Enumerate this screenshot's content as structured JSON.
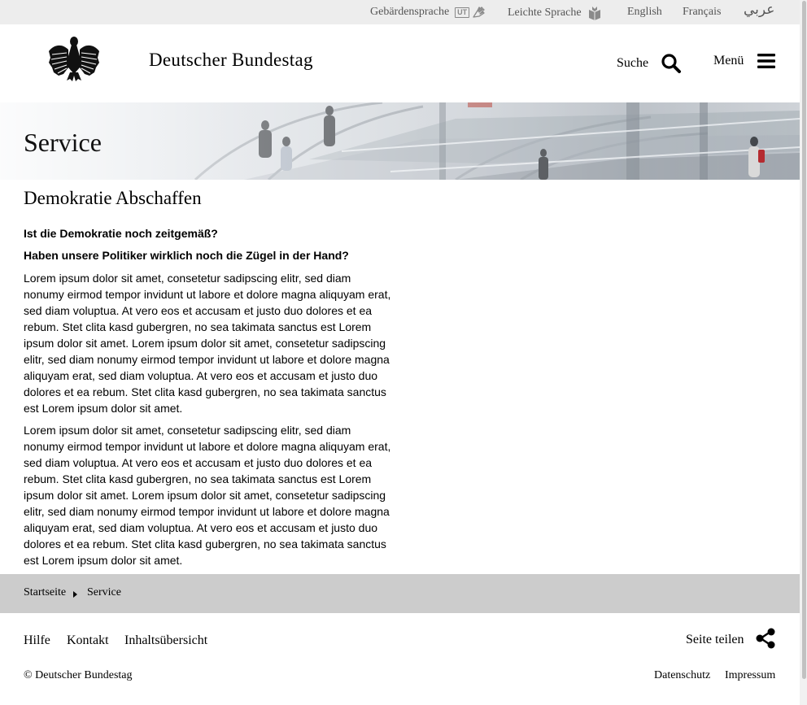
{
  "top_bar": {
    "sign_language": "Gebärdensprache",
    "sign_language_badge": "UT",
    "easy_language": "Leichte Sprache",
    "english": "English",
    "french": "Français",
    "arabic": "عربي"
  },
  "header": {
    "site_title": "Deutscher Bundestag",
    "search_label": "Suche",
    "menu_label": "Menü"
  },
  "hero": {
    "title": "Service"
  },
  "main": {
    "heading": "Demokratie Abschaffen",
    "lead_1": "Ist die Demokratie noch zeitgemäß?",
    "lead_2": "Haben unsere Politiker wirklich noch die Zügel in der Hand?",
    "paragraph_1": "Lorem ipsum dolor sit amet, consetetur sadipscing elitr, sed diam nonumy eirmod tempor invidunt ut labore et dolore magna aliquyam erat, sed diam voluptua. At vero eos et accusam et justo duo dolores et ea rebum. Stet clita kasd gubergren, no sea takimata sanctus est Lorem ipsum dolor sit amet. Lorem ipsum dolor sit amet, consetetur sadipscing elitr, sed diam nonumy eirmod tempor invidunt ut labore et dolore magna aliquyam erat, sed diam voluptua. At vero eos et accusam et justo duo dolores et ea rebum. Stet clita kasd gubergren, no sea takimata sanctus est Lorem ipsum dolor sit amet.",
    "paragraph_2": "Lorem ipsum dolor sit amet, consetetur sadipscing elitr, sed diam nonumy eirmod tempor invidunt ut labore et dolore magna aliquyam erat, sed diam voluptua. At vero eos et accusam et justo duo dolores et ea rebum. Stet clita kasd gubergren, no sea takimata sanctus est Lorem ipsum dolor sit amet. Lorem ipsum dolor sit amet, consetetur sadipscing elitr, sed diam nonumy eirmod tempor invidunt ut labore et dolore magna aliquyam erat, sed diam voluptua. At vero eos et accusam et justo duo dolores et ea rebum. Stet clita kasd gubergren, no sea takimata sanctus est Lorem ipsum dolor sit amet."
  },
  "breadcrumb": {
    "items": [
      "Startseite",
      "Service"
    ]
  },
  "footer": {
    "links": [
      "Hilfe",
      "Kontakt",
      "Inhaltsübersicht"
    ],
    "share_label": "Seite teilen",
    "copyright": "© Deutscher Bundestag",
    "privacy": "Datenschutz",
    "imprint": "Impressum"
  },
  "icons": {
    "sign_language": "hand-sign-icon",
    "easy_language": "easy-language-icon",
    "search": "search-icon",
    "menu": "hamburger-menu-icon",
    "share": "share-icon",
    "logo": "federal-eagle-logo",
    "breadcrumb_separator": "caret-right-icon"
  },
  "colors": {
    "top_bar_bg": "#ededed",
    "breadcrumb_bg": "#cccccc",
    "text": "#000000",
    "top_bar_text": "#555555"
  }
}
